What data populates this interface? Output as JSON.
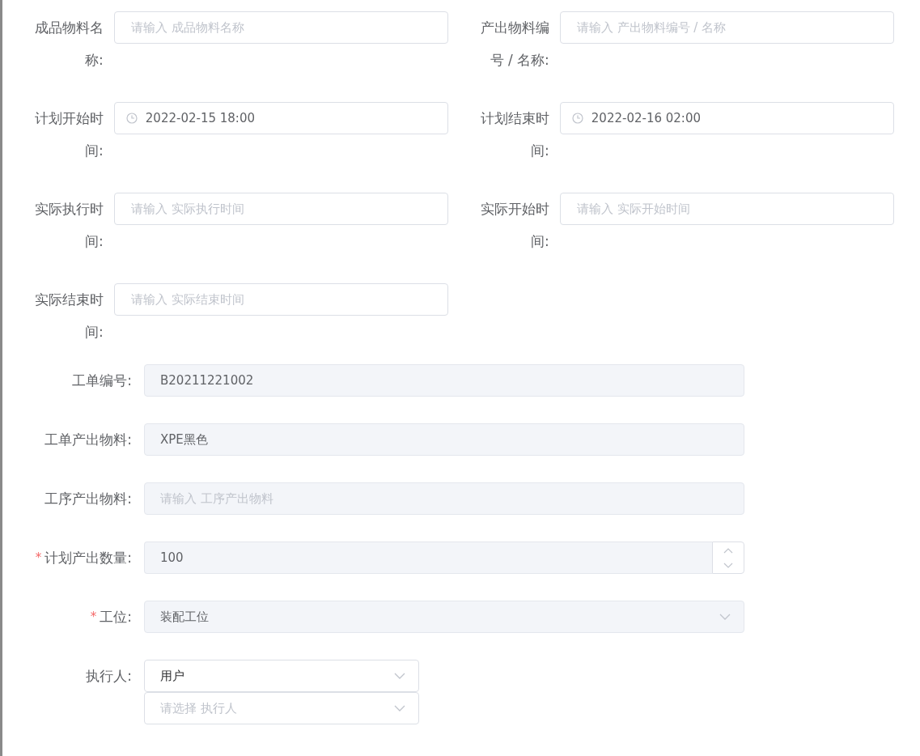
{
  "top_fields": [
    {
      "label": "成品物料名称:",
      "kind": "text",
      "placeholder": "请输入 成品物料名称"
    },
    {
      "label": "产出物料编号 / 名称:",
      "kind": "text",
      "placeholder": "请输入 产出物料编号 / 名称"
    },
    {
      "label": "计划开始时间:",
      "kind": "date",
      "value": "2022-02-15 18:00"
    },
    {
      "label": "计划结束时间:",
      "kind": "date",
      "value": "2022-02-16 02:00"
    },
    {
      "label": "实际执行时间:",
      "kind": "text",
      "placeholder": "请输入 实际执行时间"
    },
    {
      "label": "实际开始时间:",
      "kind": "text",
      "placeholder": "请输入 实际开始时间"
    },
    {
      "label": "实际结束时间:",
      "kind": "text",
      "placeholder": "请输入 实际结束时间"
    }
  ],
  "bottom_fields": [
    {
      "label": "工单编号:",
      "kind": "text",
      "disabled": true,
      "value": "B20211221002"
    },
    {
      "label": "工单产出物料:",
      "kind": "text",
      "disabled": true,
      "value": "XPE黑色"
    },
    {
      "label": "工序产出物料:",
      "kind": "text",
      "disabled": true,
      "placeholder": "请输入 工序产出物料"
    },
    {
      "label": "计划产出数量:",
      "kind": "number",
      "required_mark": "*",
      "disabled": true,
      "value": "100"
    },
    {
      "label": "工位:",
      "kind": "select",
      "required_mark": "*",
      "disabled": true,
      "value": "装配工位"
    }
  ],
  "executor": {
    "label": "执行人:",
    "selects": [
      {
        "value": "用户",
        "disabled": false
      },
      {
        "placeholder": "请选择 执行人",
        "disabled": false
      }
    ]
  }
}
